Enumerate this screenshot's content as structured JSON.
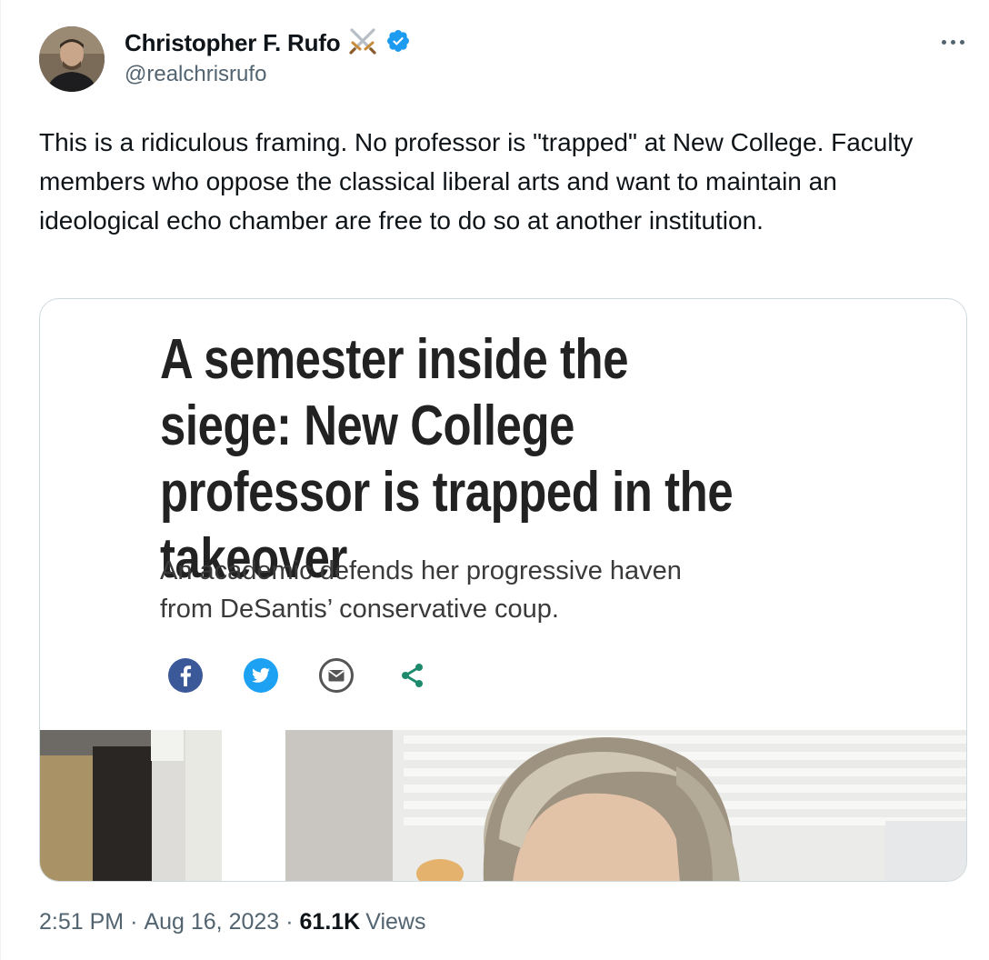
{
  "author": {
    "display_name": "Christopher F. Rufo",
    "handle": "@realchrisrufo",
    "name_emoji": "crossed-swords-icon",
    "verified": true,
    "verified_color": "#1d9bf0"
  },
  "tweet": {
    "text": "This is a ridiculous framing. No professor is \"trapped\" at New College. Faculty members who oppose the classical liberal arts and want to maintain an ideological echo chamber are free to do so at another institution."
  },
  "card": {
    "headline": "A semester inside the siege: New College professor is trapped in the takeover",
    "subhead": "An academic defends her progressive haven from DeSantis’ conservative coup.",
    "share_icons": [
      "facebook-icon",
      "twitter-icon",
      "email-icon",
      "share-icon"
    ],
    "colors": {
      "facebook": "#3b5998",
      "twitter": "#1da1f2",
      "email": "#555555",
      "share": "#1d8a6e"
    }
  },
  "meta": {
    "time": "2:51 PM",
    "separator": "·",
    "date": "Aug 16, 2023",
    "views_count": "61.1K",
    "views_label": "Views"
  }
}
